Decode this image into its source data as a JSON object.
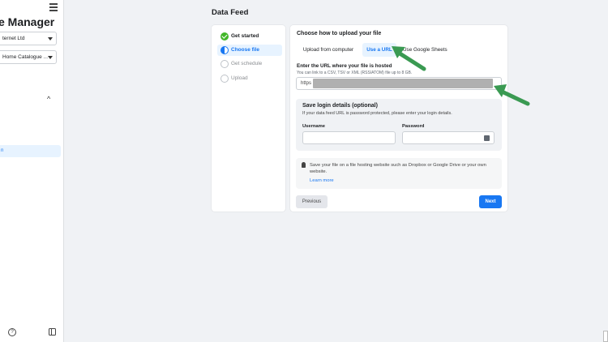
{
  "sidebar": {
    "app_title": "e Manager",
    "account_select": "ternet Ltd",
    "catalogue_select": "Home Catalogue ...",
    "active_item": "n"
  },
  "page": {
    "title": "Data Feed"
  },
  "steps": [
    {
      "label": "Get started",
      "state": "done"
    },
    {
      "label": "Choose file",
      "state": "active"
    },
    {
      "label": "Get schedule",
      "state": "todo"
    },
    {
      "label": "Upload",
      "state": "todo"
    }
  ],
  "main": {
    "heading": "Choose how to upload your file",
    "tabs": [
      {
        "label": "Upload from computer"
      },
      {
        "label": "Use a URL"
      },
      {
        "label": "Use Google Sheets"
      }
    ],
    "url_label": "Enter the URL where your file is hosted",
    "url_hint": "You can link to a CSV, TSV or XML (RSS/ATOM) file up to 8 GB.",
    "url_value": "https",
    "login": {
      "title": "Save login details (optional)",
      "desc": "If your data feed URL is password protected, please enter your login details.",
      "username_label": "Username",
      "password_label": "Password"
    },
    "tip": {
      "text": "Save your file on a file hosting website such as Dropbox or Google Drive or your own website.",
      "link": "Learn more"
    },
    "previous_label": "Previous",
    "next_label": "Next"
  },
  "colors": {
    "accent": "#1877f2",
    "success": "#42b72a",
    "annotation_arrow": "#3a9a52"
  }
}
